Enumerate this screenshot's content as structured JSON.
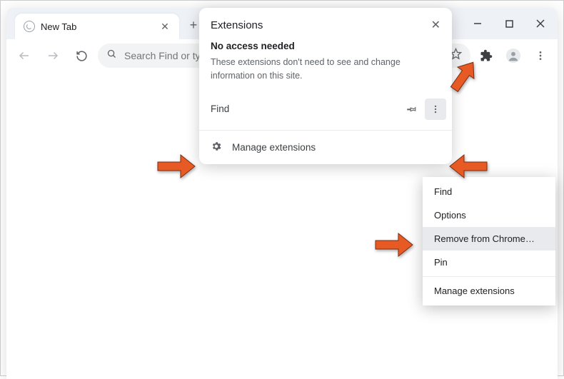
{
  "tab": {
    "title": "New Tab"
  },
  "omnibox": {
    "placeholder": "Search Find or type a URL"
  },
  "ext_popup": {
    "title": "Extensions",
    "subheading": "No access needed",
    "description": "These extensions don't need to see and change information on this site.",
    "item_label": "Find",
    "manage_label": "Manage extensions"
  },
  "context_menu": {
    "items": [
      "Find",
      "Options",
      "Remove from Chrome…",
      "Pin",
      "Manage extensions"
    ]
  }
}
